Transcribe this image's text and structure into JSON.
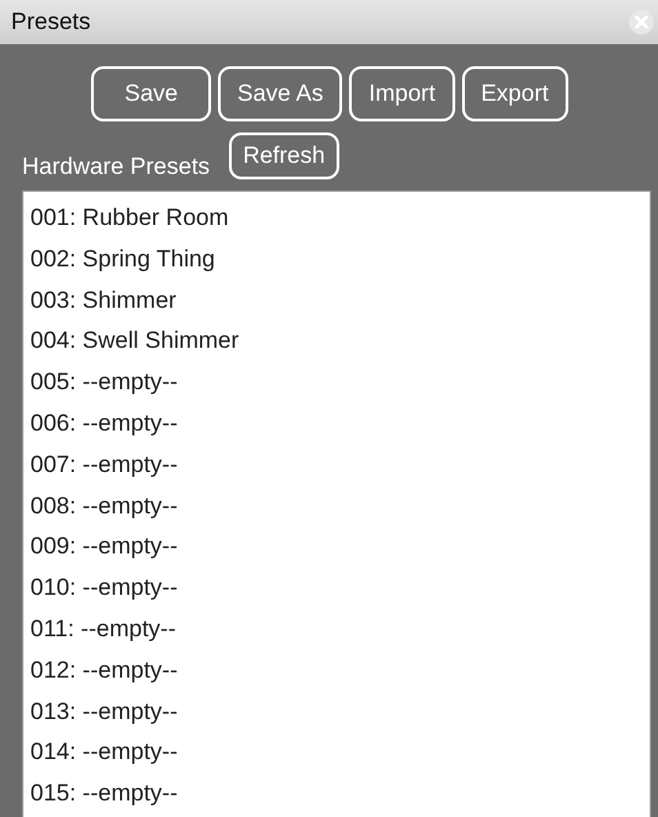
{
  "window": {
    "title": "Presets"
  },
  "buttons": [
    "Save",
    "Save As",
    "Import",
    "Export"
  ],
  "hardware": {
    "label": "Hardware Presets",
    "refresh_button": "Refresh"
  },
  "presets": [
    "001: Rubber Room",
    "002: Spring Thing",
    "003: Shimmer",
    "004: Swell Shimmer",
    "005: --empty--",
    "006: --empty--",
    "007: --empty--",
    "008: --empty--",
    "009: --empty--",
    "010: --empty--",
    "011: --empty--",
    "012: --empty--",
    "013: --empty--",
    "014: --empty--",
    "015: --empty--"
  ]
}
